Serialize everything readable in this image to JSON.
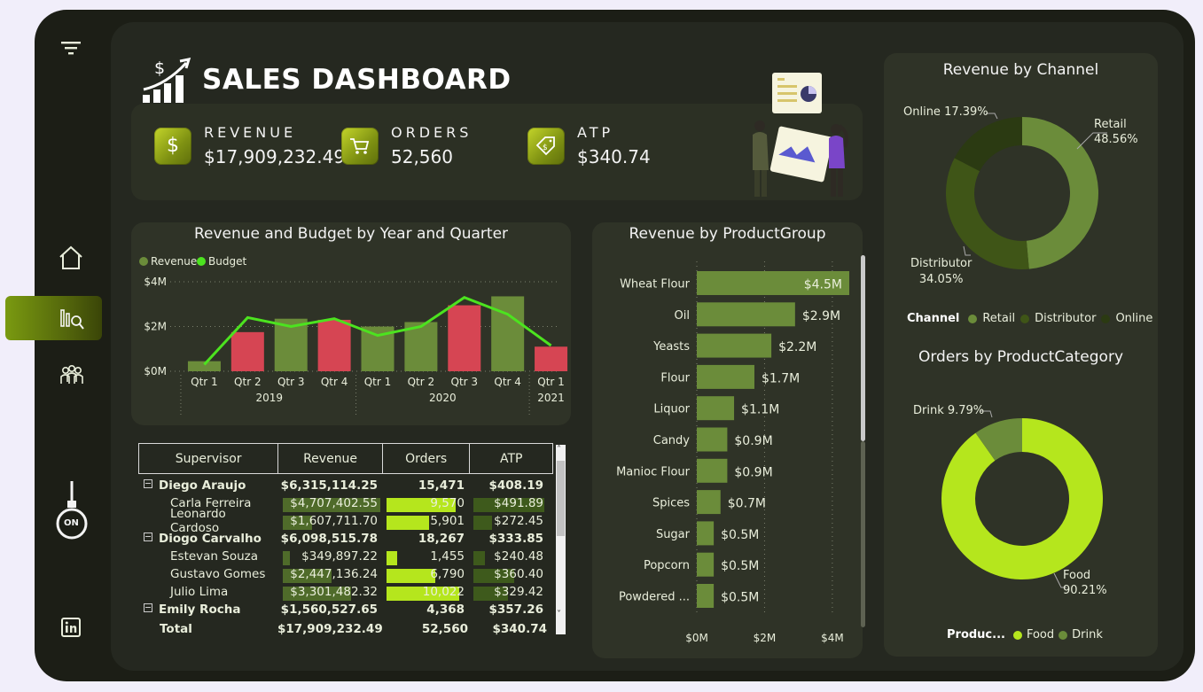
{
  "header": {
    "title": "SALES DASHBOARD"
  },
  "kpis": [
    {
      "label": "REVENUE",
      "value": "$17,909,232.49",
      "icon": "dollar-icon"
    },
    {
      "label": "ORDERS",
      "value": "52,560",
      "icon": "cart-icon"
    },
    {
      "label": "ATP",
      "value": "$340.74",
      "icon": "tag-icon"
    }
  ],
  "sidebar": {
    "icons": [
      "filter-icon",
      "home-icon",
      "analytics-icon",
      "people-icon",
      "lightbulb-on-icon",
      "linkedin-icon"
    ],
    "bulb_label": "ON"
  },
  "colors": {
    "accent": "#b5e61d",
    "revenue_green": "#6b8c3a",
    "budget_line": "#4ce31f",
    "below_budget": "#d64553",
    "online": "#2b3a12",
    "distributor": "#3f5517"
  },
  "revenue_budget": {
    "title": "Revenue and Budget by Year and Quarter",
    "legend": [
      "Revenue",
      "Budget"
    ],
    "yticks": [
      "$4M",
      "$2M",
      "$0M"
    ],
    "quarters": [
      "Qtr 1",
      "Qtr 2",
      "Qtr 3",
      "Qtr 4",
      "Qtr 1",
      "Qtr 2",
      "Qtr 3",
      "Qtr 4",
      "Qtr 1"
    ],
    "years": [
      "2019",
      "2020",
      "2021"
    ],
    "chart_data": {
      "type": "bar",
      "categories": [
        "2019 Qtr 1",
        "2019 Qtr 2",
        "2019 Qtr 3",
        "2019 Qtr 4",
        "2020 Qtr 1",
        "2020 Qtr 2",
        "2020 Qtr 3",
        "2020 Qtr 4",
        "2021 Qtr 1"
      ],
      "series": [
        {
          "name": "Revenue",
          "values": [
            0.45,
            1.75,
            2.35,
            2.3,
            2.0,
            2.2,
            2.95,
            3.35,
            1.1
          ]
        },
        {
          "name": "Budget",
          "values": [
            0.3,
            2.4,
            2.0,
            2.35,
            1.6,
            2.0,
            3.3,
            2.55,
            1.15
          ]
        }
      ],
      "below_budget": [
        false,
        true,
        false,
        true,
        false,
        false,
        true,
        false,
        true
      ],
      "ylim": [
        0,
        4.2
      ],
      "unit": "$M"
    }
  },
  "product_group": {
    "title": "Revenue by ProductGroup",
    "xticks": [
      "$0M",
      "$2M",
      "$4M"
    ],
    "chart_data": {
      "type": "bar",
      "categories": [
        "Wheat Flour",
        "Oil",
        "Yeasts",
        "Flour",
        "Liquor",
        "Candy",
        "Manioc Flour",
        "Spices",
        "Sugar",
        "Popcorn",
        "Powdered ..."
      ],
      "values": [
        4.5,
        2.9,
        2.2,
        1.7,
        1.1,
        0.9,
        0.9,
        0.7,
        0.5,
        0.5,
        0.5
      ],
      "labels": [
        "$4.5M",
        "$2.9M",
        "$2.2M",
        "$1.7M",
        "$1.1M",
        "$0.9M",
        "$0.9M",
        "$0.7M",
        "$0.5M",
        "$0.5M",
        "$0.5M"
      ],
      "xlim": [
        0,
        4.5
      ]
    }
  },
  "channel": {
    "title": "Revenue by Channel",
    "legend_title": "Channel",
    "chart_data": {
      "type": "pie",
      "categories": [
        "Retail",
        "Distributor",
        "Online"
      ],
      "values": [
        48.56,
        34.05,
        17.39
      ],
      "labels": [
        "Retail\n48.56%",
        "Distributor\n34.05%",
        "Online 17.39%"
      ]
    },
    "label_retail": "Retail",
    "label_retail_pct": "48.56%",
    "label_distributor": "Distributor",
    "label_distributor_pct": "34.05%",
    "label_online": "Online 17.39%"
  },
  "category": {
    "title": "Orders by ProductCategory",
    "legend_title": "Produc...",
    "chart_data": {
      "type": "pie",
      "categories": [
        "Food",
        "Drink"
      ],
      "values": [
        90.21,
        9.79
      ]
    },
    "label_food": "Food",
    "label_food_pct": "90.21%",
    "label_drink": "Drink 9.79%"
  },
  "table": {
    "columns": [
      "Supervisor",
      "Revenue",
      "Orders",
      "ATP"
    ],
    "rows": [
      {
        "level": 0,
        "name": "Diego Araujo",
        "revenue": "$6,315,114.25",
        "orders": "15,471",
        "atp": "$408.19"
      },
      {
        "level": 1,
        "name": "Carla Ferreira",
        "revenue": "$4,707,402.55",
        "orders": "9,570",
        "atp": "$491.89",
        "rev_frac": 1.0,
        "ord_frac": 0.85,
        "atp_frac": 0.95
      },
      {
        "level": 1,
        "name": "Leonardo Cardoso",
        "revenue": "$1,607,711.70",
        "orders": "5,901",
        "atp": "$272.45",
        "rev_frac": 0.3,
        "ord_frac": 0.52,
        "atp_frac": 0.25
      },
      {
        "level": 0,
        "name": "Diogo Carvalho",
        "revenue": "$6,098,515.78",
        "orders": "18,267",
        "atp": "$333.85"
      },
      {
        "level": 1,
        "name": "Estevan Souza",
        "revenue": "$349,897.22",
        "orders": "1,455",
        "atp": "$240.48",
        "rev_frac": 0.07,
        "ord_frac": 0.13,
        "atp_frac": 0.16
      },
      {
        "level": 1,
        "name": "Gustavo Gomes",
        "revenue": "$2,447,136.24",
        "orders": "6,790",
        "atp": "$360.40",
        "rev_frac": 0.5,
        "ord_frac": 0.6,
        "atp_frac": 0.55
      },
      {
        "level": 1,
        "name": "Julio Lima",
        "revenue": "$3,301,482.32",
        "orders": "10,022",
        "atp": "$329.42",
        "rev_frac": 0.7,
        "ord_frac": 0.89,
        "atp_frac": 0.47
      },
      {
        "level": 0,
        "name": "Emily Rocha",
        "revenue": "$1,560,527.65",
        "orders": "4,368",
        "atp": "$357.26"
      }
    ],
    "total": {
      "name": "Total",
      "revenue": "$17,909,232.49",
      "orders": "52,560",
      "atp": "$340.74"
    }
  }
}
